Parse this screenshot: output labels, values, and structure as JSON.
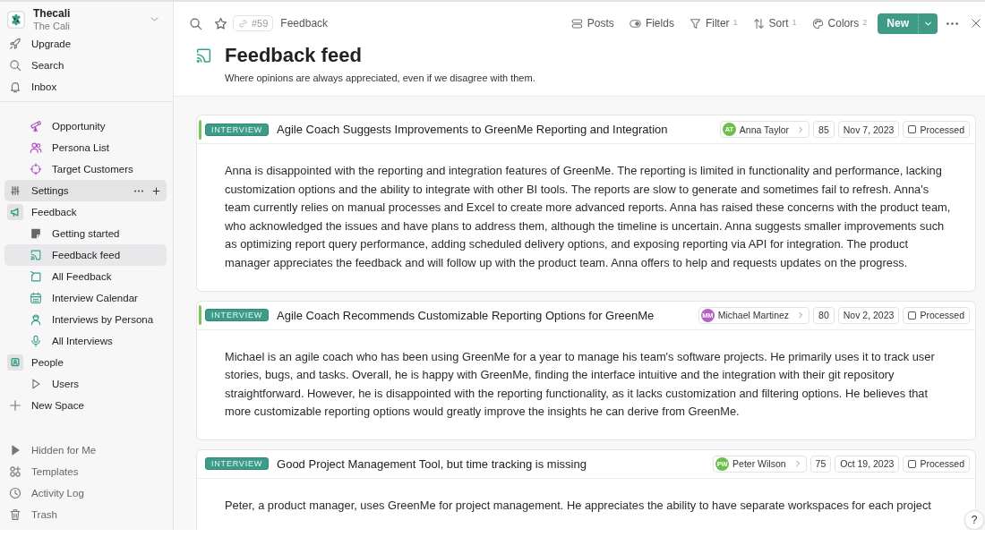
{
  "sidebar": {
    "workspace": {
      "name": "Thecali",
      "subtitle": "The Cali"
    },
    "quick_links": [
      {
        "label": "Upgrade"
      },
      {
        "label": "Search"
      },
      {
        "label": "Inbox"
      }
    ],
    "tree": [
      {
        "children": [
          {
            "label": "Opportunity",
            "selected": false
          },
          {
            "label": "Persona List",
            "selected": false
          },
          {
            "label": "Target Customers",
            "selected": false
          }
        ]
      },
      {
        "label": "Settings",
        "selected": false,
        "hovered": true
      },
      {
        "label": "Feedback",
        "selected": false,
        "hovered": false,
        "children": [
          {
            "label": "Getting started",
            "selected": false
          },
          {
            "label": "Feedback feed",
            "selected": true
          },
          {
            "label": "All Feedback",
            "selected": false
          },
          {
            "label": "Interview Calendar",
            "selected": false
          },
          {
            "label": "Interviews by Persona",
            "selected": false
          },
          {
            "label": "All Interviews",
            "selected": false
          }
        ]
      },
      {
        "label": "People",
        "selected": false,
        "hovered": false,
        "children": [
          {
            "label": "Users",
            "selected": false
          }
        ]
      }
    ],
    "new_space": "New Space",
    "footer": [
      {
        "label": "Hidden for Me"
      },
      {
        "label": "Templates"
      },
      {
        "label": "Activity Log"
      },
      {
        "label": "Trash"
      }
    ]
  },
  "toolbar": {
    "ref": "#59",
    "breadcrumb": "Feedback",
    "views": [
      {
        "label": "Posts"
      },
      {
        "label": "Fields"
      },
      {
        "label": "Filter",
        "count": "1"
      },
      {
        "label": "Sort",
        "count": "1"
      },
      {
        "label": "Colors",
        "count": "2"
      }
    ],
    "new_button": "New"
  },
  "page": {
    "title": "Feedback feed",
    "subtitle": "Where opinions are always appreciated, even if we disagree with them."
  },
  "posts": [
    {
      "marked": true,
      "tag": "INTERVIEW",
      "title": "Agile Coach Suggests Improvements to GreenMe Reporting and Integration",
      "person": {
        "initials": "AT",
        "name": "Anna Taylor",
        "color": "#6cc04a"
      },
      "score": "85",
      "date": "Nov 7, 2023",
      "processed": {
        "label": "Processed",
        "checked": false
      },
      "body": "Anna is disappointed with the reporting and integration features of GreenMe. The reporting is limited in functionality and performance, lacking customization options and the ability to integrate with other BI tools. The reports are slow to generate and sometimes fail to refresh. Anna's team currently relies on manual processes and Excel to create more advanced reports. Anna has raised these concerns with the product team, who acknowledged the issues and have plans to address them, although the timeline is uncertain. Anna suggests smaller improvements such as optimizing report query performance, adding scheduled delivery options, and exposing reporting via API for integration. The product manager appreciates the feedback and will follow up with the product team. Anna offers to help and requests updates on the progress."
    },
    {
      "marked": true,
      "tag": "INTERVIEW",
      "title": "Agile Coach Recommends Customizable Reporting Options for GreenMe",
      "person": {
        "initials": "MM",
        "name": "Michael Martinez",
        "color": "#b65fc9"
      },
      "score": "80",
      "date": "Nov 2, 2023",
      "processed": {
        "label": "Processed",
        "checked": false
      },
      "body": "Michael is an agile coach who has been using GreenMe for a year to manage his team's software projects. He primarily uses it to track user stories, bugs, and tasks. Overall, he is happy with GreenMe, finding the interface intuitive and the integration with their git repository straightforward. However, he is disappointed with the reporting functionality, as it lacks customization and filtering options. He believes that more customizable reporting options would greatly improve the insights he can derive from GreenMe."
    },
    {
      "marked": false,
      "tag": "INTERVIEW",
      "title": "Good Project Management Tool, but time tracking is missing",
      "person": {
        "initials": "PW",
        "name": "Peter Wilson",
        "color": "#6cc04a"
      },
      "score": "75",
      "date": "Oct 19, 2023",
      "processed": {
        "label": "Processed",
        "checked": false
      },
      "body": "Peter, a product manager, uses GreenMe for project management. He appreciates the ability to have separate workspaces for each project"
    }
  ],
  "help_button": "?"
}
